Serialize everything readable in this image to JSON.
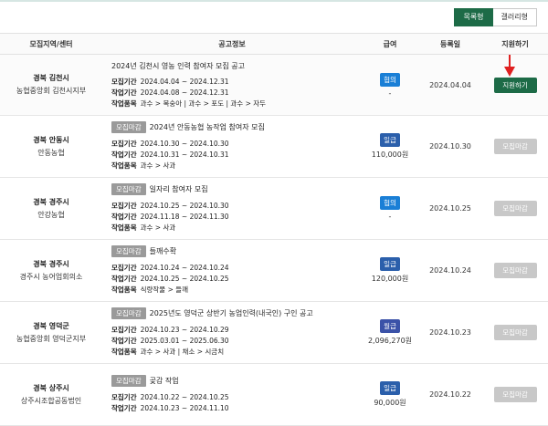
{
  "view_toggle": {
    "list_label": "목록형",
    "gallery_label": "갤러리형"
  },
  "columns": [
    "모집지역/센터",
    "공고정보",
    "급여",
    "등록일",
    "지원하기"
  ],
  "labels": {
    "recruit_period": "모집기간",
    "work_period": "작업기간",
    "work_item": "작업품목",
    "closed_badge": "모집마감"
  },
  "colors": {
    "brand_green": "#1d6b47",
    "arrow_red": "#e02020"
  },
  "rows": [
    {
      "region": "경북 김천시",
      "center": "농협중앙회 김천시지부",
      "closed": false,
      "title": "2024년 김천시 영농 인력 참여자 모집 공고",
      "recruit": "2024.04.04 ~ 2024.12.31",
      "work": "2024.04.08 ~ 2024.12.31",
      "item": "과수 > 복숭아 | 과수 > 포도 | 과수 > 자두",
      "pay_type": "협의",
      "pay_amount": "-",
      "date": "2024.04.04",
      "action": "지원하기"
    },
    {
      "region": "경북 안동시",
      "center": "안동농협",
      "closed": true,
      "title": "2024년 안동농협 농작업 참여자 모집",
      "recruit": "2024.10.30 ~ 2024.10.30",
      "work": "2024.10.31 ~ 2024.10.31",
      "item": "과수 > 사과",
      "pay_type": "일급",
      "pay_amount": "110,000원",
      "date": "2024.10.30",
      "action": "모집마감"
    },
    {
      "region": "경북 경주시",
      "center": "안강농협",
      "closed": true,
      "title": "일자리 참여자 모집",
      "recruit": "2024.10.25 ~ 2024.10.30",
      "work": "2024.11.18 ~ 2024.11.30",
      "item": "과수 > 사과",
      "pay_type": "협의",
      "pay_amount": "-",
      "date": "2024.10.25",
      "action": "모집마감"
    },
    {
      "region": "경북 경주시",
      "center": "경주시 농어업회의소",
      "closed": true,
      "title": "들깨수확",
      "recruit": "2024.10.24 ~ 2024.10.24",
      "work": "2024.10.25 ~ 2024.10.25",
      "item": "식량작물 > 들깨",
      "pay_type": "일급",
      "pay_amount": "120,000원",
      "date": "2024.10.24",
      "action": "모집마감"
    },
    {
      "region": "경북 영덕군",
      "center": "농협중앙회 영덕군지부",
      "closed": true,
      "title": "2025년도 영덕군 상반기 농업인력(내국인) 구인 공고",
      "recruit": "2024.10.23 ~ 2024.10.29",
      "work": "2025.03.01 ~ 2025.06.30",
      "item": "과수 > 사과 | 채소 > 시금치",
      "pay_type": "월급",
      "pay_amount": "2,096,270원",
      "date": "2024.10.23",
      "action": "모집마감"
    },
    {
      "region": "경북 상주시",
      "center": "상주시조합공동법인",
      "closed": true,
      "title": "곶감 작업",
      "recruit": "2024.10.22 ~ 2024.10.25",
      "work": "2024.10.23 ~ 2024.11.10",
      "item": "",
      "pay_type": "일급",
      "pay_amount": "90,000원",
      "date": "2024.10.22",
      "action": "모집마감"
    }
  ]
}
